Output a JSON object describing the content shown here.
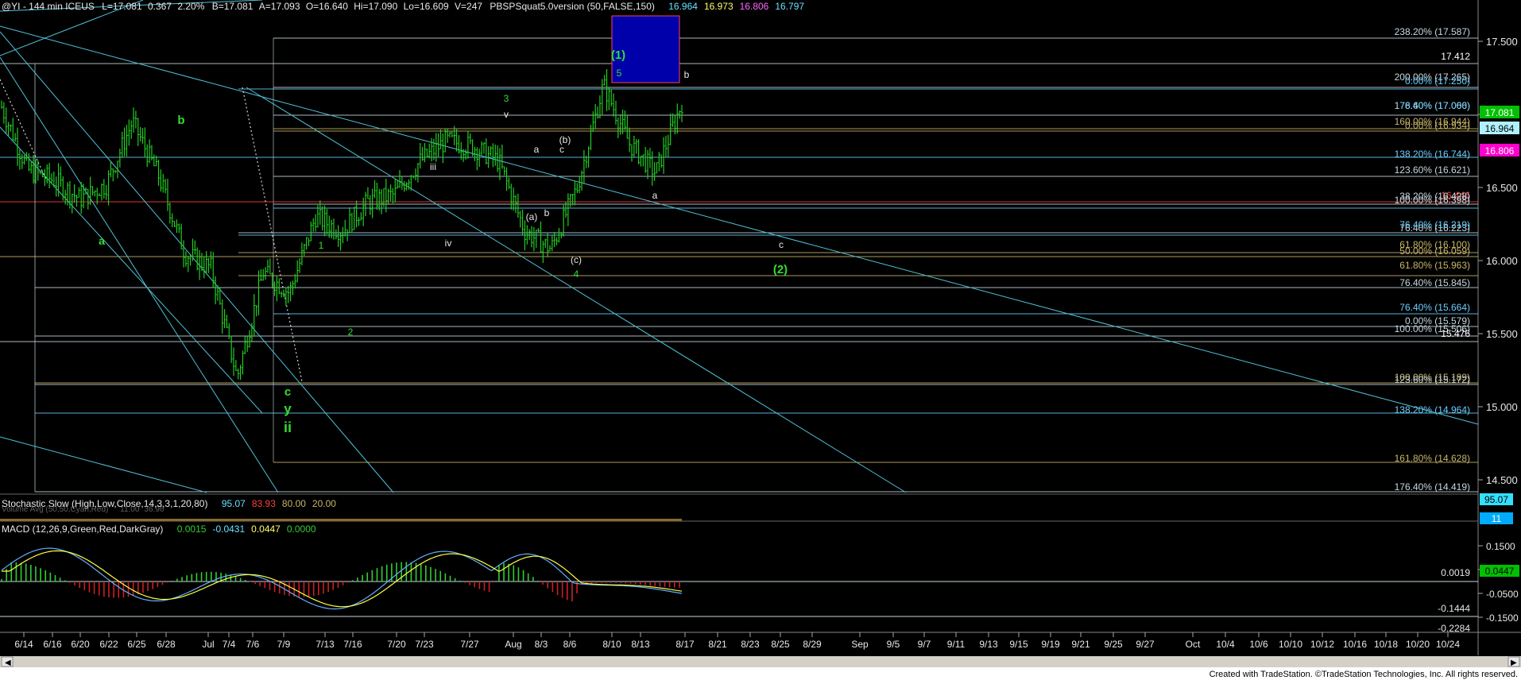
{
  "header": {
    "symbol": "@YI - 144 min  ICEUS",
    "last": "L=17.081",
    "chg": "0.367",
    "pct": "2.20%",
    "bid": "B=17.081",
    "ask": "A=17.093",
    "open": "O=16.640",
    "hi": "Hi=17.090",
    "lo": "Lo=16.609",
    "vol": "V=247",
    "study": "PBSPSquat5.0version (50,FALSE,150)",
    "study_vals": [
      {
        "v": "16.964",
        "color": "#66e0ff"
      },
      {
        "v": "16.973",
        "color": "#ffff66"
      },
      {
        "v": "16.806",
        "color": "#ff66ff"
      },
      {
        "v": "16.797",
        "color": "#66e0ff"
      }
    ]
  },
  "colors": {
    "background": "#000000",
    "up_bar": "#22cc22",
    "trendline": "#4fc3d9",
    "fib_line": "#c8d8e0",
    "wave_green": "#33dd33",
    "wave_white": "#e8e8e8",
    "box_fill": "#0000aa",
    "box_border": "#ff4060",
    "macd": "#33cc33",
    "macd_neg": "#cc2020",
    "signal": "#ffff40",
    "hist_line": "#5fb0ff"
  },
  "price_axis": {
    "ticks": [
      "17.500",
      "17.000",
      "16.500",
      "16.000",
      "15.500",
      "15.000",
      "14.500"
    ],
    "tags": [
      {
        "text": "17.081",
        "bg": "#00c000",
        "fg": "#ffffff"
      },
      {
        "text": "16.964",
        "bg": "#b0f0ff",
        "fg": "#000000"
      },
      {
        "text": "16.806",
        "bg": "#ff00cc",
        "fg": "#ffffff"
      }
    ]
  },
  "fib_levels": [
    {
      "text": "238.20% (17.587)",
      "color": "#c8d8e0"
    },
    {
      "text": "17.412",
      "color": "#ffffff"
    },
    {
      "text": "200.00% (17.265)",
      "color": "#c8d8e0"
    },
    {
      "text": "0.00% (17.250)",
      "color": "#6ad0ff"
    },
    {
      "text": "176.40% (17.066)",
      "color": "#c8d8e0"
    },
    {
      "text": "78.60% (17.000)",
      "color": "#6ad0ff"
    },
    {
      "text": "0.00% (16.934)",
      "color": "#c9b56a"
    },
    {
      "text": "160.00% (16.944)",
      "color": "#c9b56a"
    },
    {
      "text": "138.20% (16.744)",
      "color": "#6ad0ff"
    },
    {
      "text": "123.60% (16.621)",
      "color": "#c8d8e0"
    },
    {
      "text": "16.446",
      "color": "#ff4040"
    },
    {
      "text": "38.20% (16.428)",
      "color": "#c8d8e0"
    },
    {
      "text": "100.00% (16.398)",
      "color": "#c8d8e0"
    },
    {
      "text": "76.40% (16.223)",
      "color": "#c8d8e0"
    },
    {
      "text": "76.40% (16.219)",
      "color": "#6ad0ff"
    },
    {
      "text": "61.80% (16.100)",
      "color": "#c9b56a"
    },
    {
      "text": "50.00% (16.059)",
      "color": "#c9b56a"
    },
    {
      "text": "61.80% (15.963)",
      "color": "#c9b56a"
    },
    {
      "text": "76.40% (15.845)",
      "color": "#c8d8e0"
    },
    {
      "text": "76.40% (15.664)",
      "color": "#6ad0ff"
    },
    {
      "text": "0.00% (15.579)",
      "color": "#c8d8e0"
    },
    {
      "text": "100.00% (15.506)",
      "color": "#c8d8e0"
    },
    {
      "text": "15.476",
      "color": "#ffffff"
    },
    {
      "text": "100.00% (15.189)",
      "color": "#c9b56a"
    },
    {
      "text": "123.60% (15.172)",
      "color": "#c8d8e0"
    },
    {
      "text": "138.20% (14.964)",
      "color": "#6ad0ff"
    },
    {
      "text": "161.80% (14.628)",
      "color": "#c9b56a"
    },
    {
      "text": "176.40% (14.419)",
      "color": "#c8d8e0"
    }
  ],
  "wave_labels": {
    "green": [
      "b",
      "a",
      "1",
      "2",
      "3",
      "4",
      "(1)",
      "(2)",
      "c",
      "y",
      "ii",
      "5"
    ],
    "white": [
      "v",
      "iii",
      "iv",
      "a",
      "b",
      "c",
      "(a)",
      "(b)",
      "(c)",
      "a",
      "b",
      "c"
    ]
  },
  "stochastic": {
    "title": "Stochastic Slow (High,Low,Close,14,3,3,1,20,80)",
    "vals": [
      "95.07",
      "83.93",
      "80.00",
      "20.00"
    ],
    "vals_colors": [
      "#66e0ff",
      "#ff4040",
      "#c9b56a",
      "#c9b56a"
    ],
    "overlap_title": "Volume Avg (50,50,Cyan,Red)",
    "overlap_vals": [
      "11.00",
      "36.96"
    ],
    "axis_tags": [
      {
        "text": "95.07",
        "bg": "#33e0ff",
        "fg": "#000000"
      },
      {
        "text": "11",
        "bg": "#00aaff",
        "fg": "#ffffff"
      }
    ]
  },
  "macd": {
    "title": "MACD (12,26,9,Green,Red,DarkGray)",
    "vals": [
      "0.0015",
      "-0.0431",
      "0.0447",
      "0.0000"
    ],
    "vals_colors": [
      "#33cc33",
      "#66e0ff",
      "#ffff66",
      "#33cc33"
    ],
    "axis_ticks": [
      "0.1500",
      "0.0500",
      "-0.0500",
      "-0.1500"
    ],
    "level_labels": [
      "0.0019",
      "-0.1444",
      "-0.2284"
    ],
    "axis_tags": [
      {
        "text": "0.0447",
        "bg": "#00c000",
        "fg": "#000000"
      }
    ]
  },
  "x_axis": {
    "labels": [
      "6/14",
      "6/16",
      "6/20",
      "6/22",
      "6/25",
      "6/28",
      "Jul",
      "7/4",
      "7/6",
      "7/9",
      "7/13",
      "7/16",
      "7/20",
      "7/23",
      "7/27",
      "Aug",
      "8/3",
      "8/6",
      "8/10",
      "8/13",
      "8/17",
      "8/21",
      "8/23",
      "8/25",
      "8/29",
      "Sep",
      "9/5",
      "9/7",
      "9/11",
      "9/13",
      "9/15",
      "9/19",
      "9/21",
      "9/25",
      "9/27",
      "Oct",
      "10/4",
      "10/6",
      "10/10",
      "10/12",
      "10/16",
      "10/18",
      "10/20",
      "10/24"
    ]
  },
  "footer": {
    "credit": "Created with TradeStation. ©TradeStation Technologies, Inc. All rights reserved."
  },
  "chart_data": {
    "type": "line",
    "title": "@YI - 144 min  ICEUS",
    "xlabel": "",
    "ylabel": "",
    "ylim": [
      14.3,
      17.82
    ],
    "grid": false,
    "series": [
      {
        "name": "",
        "x": [
          "6/14",
          "6/16",
          "6/20",
          "6/22",
          "6/25",
          "6/28",
          "7/2",
          "7/4",
          "7/6",
          "7/9",
          "7/11",
          "7/13",
          "7/16",
          "7/18",
          "7/20",
          "7/23",
          "7/25",
          "7/27",
          "7/30",
          "8/1",
          "8/3",
          "8/6",
          "8/8",
          "8/10",
          "8/13",
          "8/15",
          "8/16"
        ],
        "values": [
          17.05,
          16.62,
          16.55,
          16.42,
          16.52,
          16.95,
          16.58,
          16.05,
          15.95,
          15.2,
          15.92,
          15.78,
          16.3,
          16.2,
          16.4,
          16.45,
          16.68,
          16.82,
          16.78,
          16.68,
          16.2,
          16.08,
          16.5,
          17.2,
          16.8,
          16.6,
          17.08
        ]
      }
    ]
  }
}
